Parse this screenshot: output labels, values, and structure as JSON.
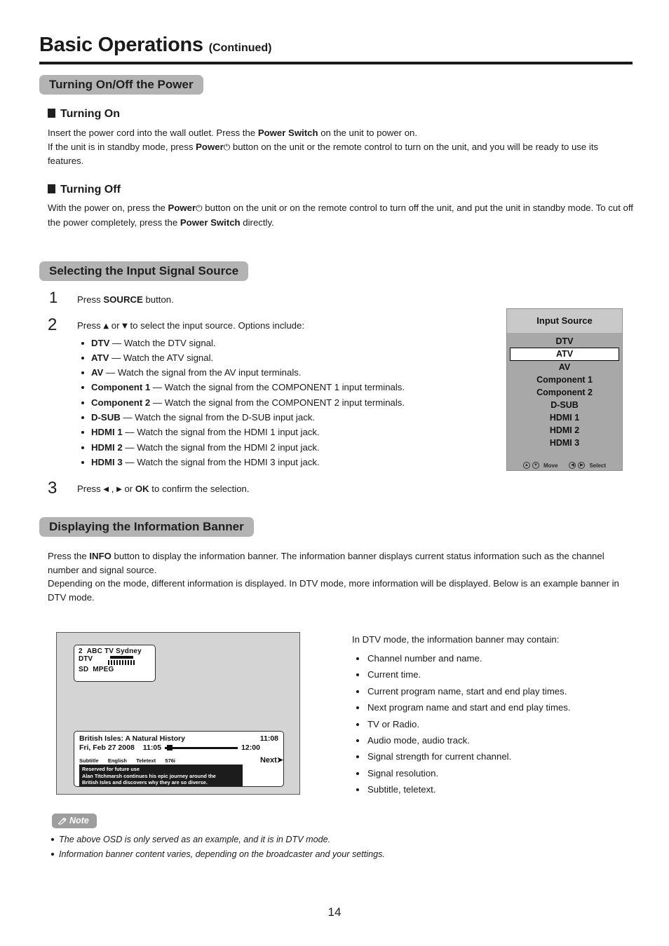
{
  "header": {
    "title": "Basic Operations",
    "subtitle": "(Continued)"
  },
  "sections": {
    "power": {
      "heading": "Turning On/Off the Power",
      "turning_on": {
        "heading": "Turning On",
        "line1_a": "Insert the power cord into the wall outlet. Press the ",
        "line1_b": "Power Switch",
        "line1_c": " on the unit to power on.",
        "line2_a": "If the unit is in standby mode, press ",
        "line2_b": "Power",
        "line2_c": " button on the unit or the remote control to turn on the unit, and you will be ready to use its features."
      },
      "turning_off": {
        "heading": "Turning Off",
        "line1_a": "With the power on, press the ",
        "line1_b": "Power",
        "line1_c": " button on the unit or on the remote control to turn off the unit, and put the unit in standby mode. To cut off the power completely, press the ",
        "line1_d": "Power Switch",
        "line1_e": " directly."
      }
    },
    "input_source": {
      "heading": "Selecting the Input Signal Source",
      "step1": {
        "num": "1",
        "text_a": "Press ",
        "text_b": "SOURCE",
        "text_c": " button."
      },
      "step2": {
        "num": "2",
        "lead_a": "Press ",
        "lead_b": " or ",
        "lead_c": " to select the input source. Options include:",
        "options": [
          {
            "name": "DTV",
            "desc": " — Watch the DTV signal."
          },
          {
            "name": "ATV",
            "desc": " — Watch the ATV signal."
          },
          {
            "name": "AV",
            "desc": " — Watch the signal from the AV input terminals."
          },
          {
            "name": "Component 1",
            "desc": " — Watch the signal from the COMPONENT 1 input terminals."
          },
          {
            "name": "Component 2",
            "desc": " — Watch the signal from the COMPONENT 2 input terminals."
          },
          {
            "name": "D-SUB",
            "desc": " — Watch the signal from the D-SUB input jack."
          },
          {
            "name": "HDMI 1",
            "desc": " — Watch the signal from the HDMI 1 input jack."
          },
          {
            "name": "HDMI 2",
            "desc": " — Watch the signal from the HDMI 2 input jack."
          },
          {
            "name": "HDMI 3",
            "desc": " — Watch the signal from the HDMI 3 input jack."
          }
        ]
      },
      "step3": {
        "num": "3",
        "text_a": "Press ",
        "text_b": " , ",
        "text_c": " or ",
        "text_d": "OK",
        "text_e": " to confirm the selection."
      }
    },
    "info_banner": {
      "heading": "Displaying the Information Banner",
      "para1_a": "Press the ",
      "para1_b": "INFO",
      "para1_c": " button to display the information banner. The information banner displays current status information such as the channel number and signal source.",
      "para2": "Depending on the mode, different information is displayed. In DTV mode, more information will be displayed. Below is an example banner in DTV mode.",
      "dtv_intro": "In DTV mode, the information banner may contain:",
      "dtv_items": [
        "Channel number and name.",
        "Current time.",
        "Current program name, start and end play times.",
        "Next program name and start and end play times.",
        "TV or Radio.",
        "Audio mode, audio track.",
        "Signal strength for current channel.",
        "Signal resolution.",
        "Subtitle, teletext."
      ]
    }
  },
  "osd": {
    "title": "Input Source",
    "items": [
      {
        "label": "DTV",
        "selected": false
      },
      {
        "label": "ATV",
        "selected": true
      },
      {
        "label": "AV",
        "selected": false
      },
      {
        "label": "Component 1",
        "selected": false
      },
      {
        "label": "Component 2",
        "selected": false
      },
      {
        "label": "D-SUB",
        "selected": false
      },
      {
        "label": "HDMI 1",
        "selected": false
      },
      {
        "label": "HDMI 2",
        "selected": false
      },
      {
        "label": "HDMI 3",
        "selected": false
      }
    ],
    "footer": {
      "move_label": "Move",
      "select_label": "Select",
      "move_up_glyph": "▲",
      "move_down_glyph": "▼",
      "select_left_glyph": "◀",
      "select_right_glyph": "▶"
    },
    "colors": {
      "title_bg": "#c9c9c9",
      "body_bg": "#a8a8a8",
      "highlight_bg": "#ffffff"
    }
  },
  "tv_mock": {
    "channel_box": {
      "number": "2",
      "name": "ABC TV Sydney",
      "mode": "DTV",
      "resolution": "SD",
      "codec": "MPEG"
    },
    "banner": {
      "program_title": "British Isles: A Natural History",
      "current_time": "11:08",
      "date": "Fri, Feb 27 2008",
      "start_time": "11:05",
      "end_time": "12:00",
      "subtitle_label": "Subtitle",
      "subtitle_value": "English",
      "teletext_label": "Teletext",
      "resolution_value": "576i",
      "next_label": "Next",
      "next_glyph": "➤",
      "description_line1": "Reserved for future use",
      "description_line2": "Alan Titchmarsh continues his epic journey around the",
      "description_line3": "British Isles and discovers why they are so diverse."
    }
  },
  "note": {
    "label": "Note",
    "lines": [
      "The above OSD is only served as an example, and it is in DTV mode.",
      "Information banner content varies, depending on the broadcaster and your settings."
    ]
  },
  "footer": {
    "page_number": "14"
  }
}
